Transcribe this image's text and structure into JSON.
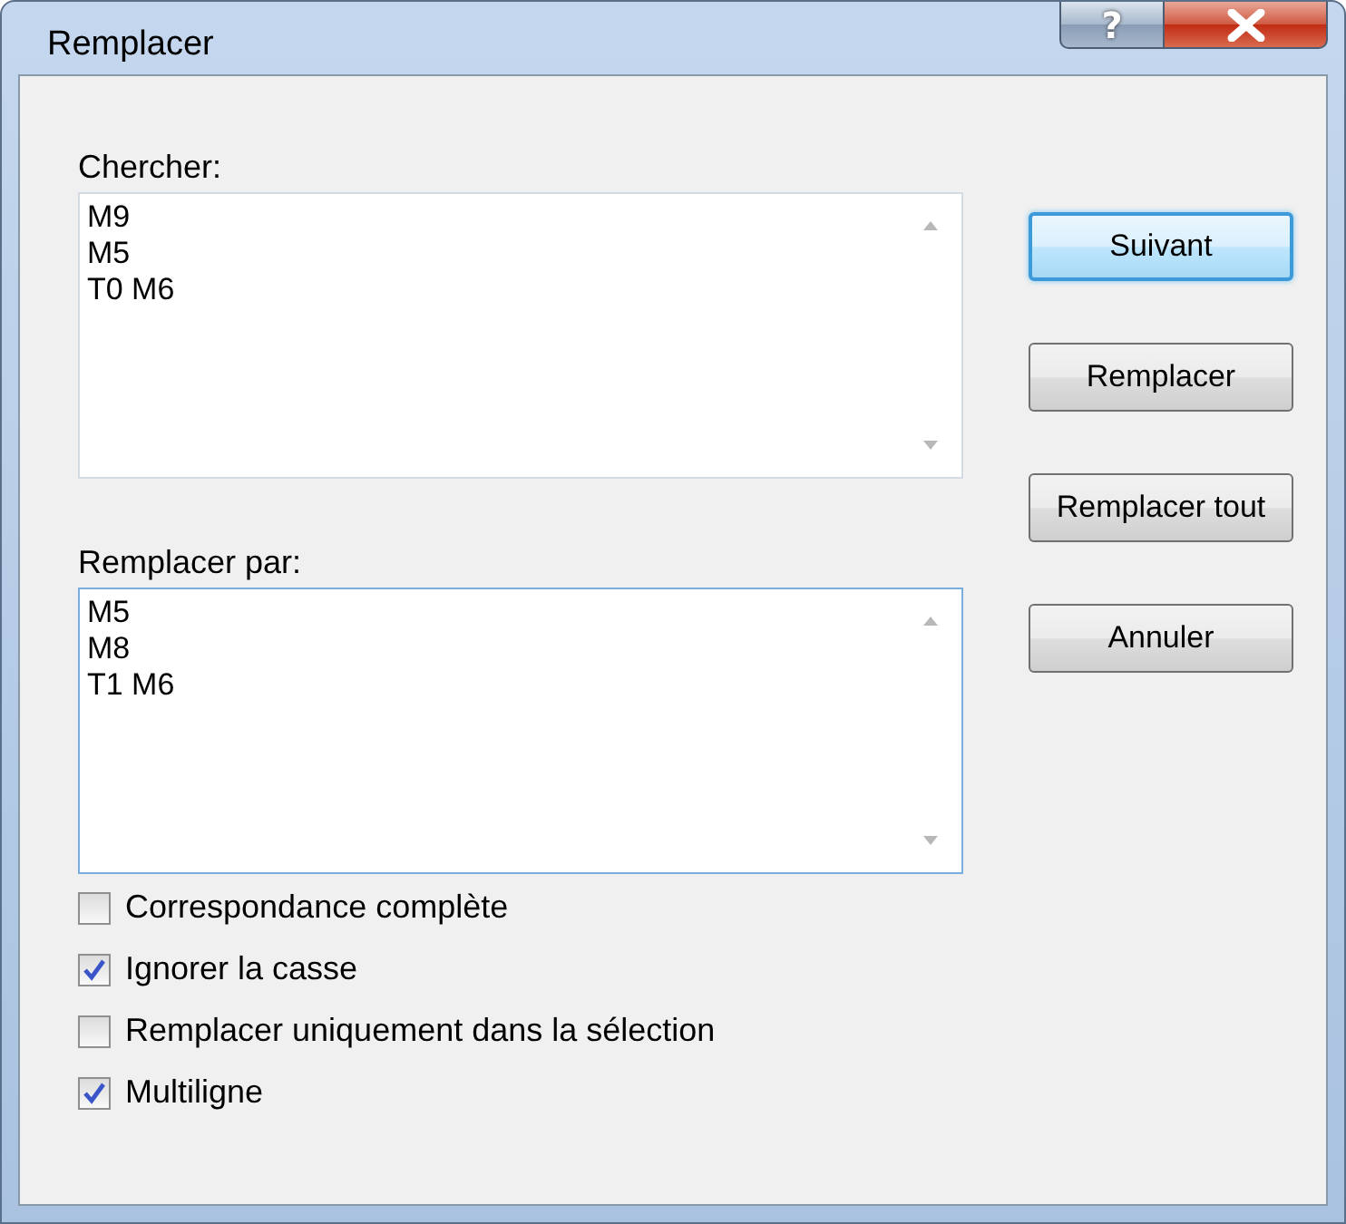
{
  "window": {
    "title": "Remplacer",
    "help_button": "?"
  },
  "search": {
    "label": "Chercher:",
    "focused": false,
    "lines": [
      "M9",
      "M5",
      "T0 M6"
    ]
  },
  "replace": {
    "label": "Remplacer par:",
    "focused": true,
    "lines": [
      "M5",
      "M8",
      "T1 M6"
    ]
  },
  "buttons": [
    {
      "label": "Suivant",
      "default": true
    },
    {
      "label": "Remplacer",
      "default": false
    },
    {
      "label": "Remplacer tout",
      "default": false
    },
    {
      "label": "Annuler",
      "default": false
    }
  ],
  "options": [
    {
      "label": "Correspondance complète",
      "checked": false
    },
    {
      "label": "Ignorer la casse",
      "checked": true
    },
    {
      "label": "Remplacer uniquement dans la sélection",
      "checked": false
    },
    {
      "label": "Multiligne",
      "checked": true
    }
  ]
}
